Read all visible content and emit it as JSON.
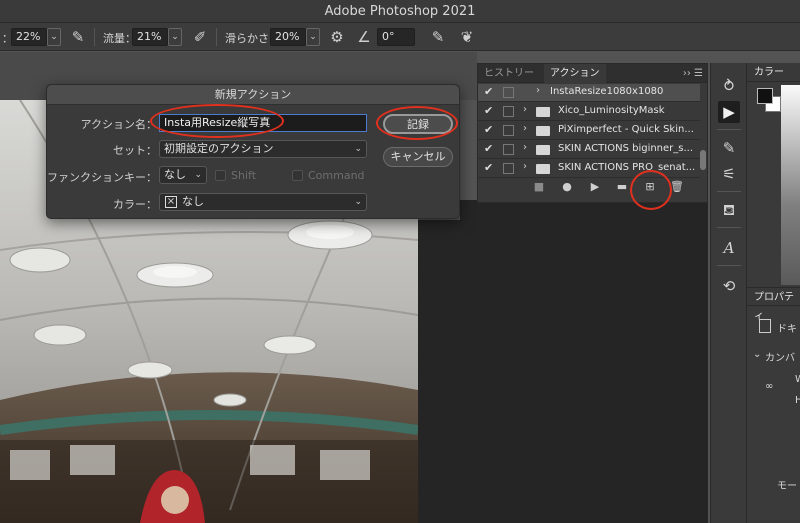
{
  "app": {
    "title": "Adobe Photoshop 2021"
  },
  "options_bar": {
    "opacity_value": "22%",
    "flow_label": "流量：",
    "flow_value": "21%",
    "smoothing_label": "滑らかさ：",
    "smoothing_value": "20%",
    "angle_value": "0°"
  },
  "dialog": {
    "title": "新規アクション",
    "name_label": "アクション名：",
    "name_value": "Insta用Resize縦写真",
    "set_label": "セット：",
    "set_value": "初期設定のアクション",
    "fkey_label": "ファンクションキー：",
    "fkey_value": "なし",
    "shift_label": "Shift",
    "command_label": "Command",
    "color_label": "カラー：",
    "color_value": "なし",
    "record_label": "記録",
    "cancel_label": "キャンセル"
  },
  "actions_panel": {
    "tabs": [
      "ヒストリー",
      "アクション"
    ],
    "collapse_glyph": "‹‹",
    "items": [
      {
        "name": "InstaResize1080x1080",
        "selected": true
      },
      {
        "name": "Xico_LuminosityMask",
        "selected": false
      },
      {
        "name": "PiXimperfect - Quick Skin...",
        "selected": false
      },
      {
        "name": "SKIN ACTIONS biginner_s...",
        "selected": false
      },
      {
        "name": "SKIN ACTIONS PRO_senat...",
        "selected": false
      }
    ]
  },
  "color_panel": {
    "title": "カラー"
  },
  "properties_panel": {
    "title": "プロパティ",
    "doc_label": "ドキ",
    "canvas_label": "カンバ",
    "w_label": "W",
    "h_label": "H",
    "mode_label": "モード"
  },
  "annotation_color": "#e0301e"
}
